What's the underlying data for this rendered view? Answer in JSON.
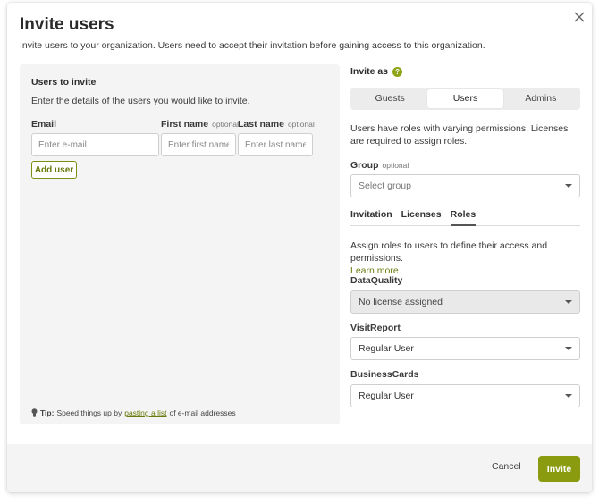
{
  "dialog": {
    "title": "Invite users",
    "subtitle": "Invite users to your organization. Users need to accept their invitation before gaining access to this organization.",
    "close_icon": "close-icon"
  },
  "users_panel": {
    "heading": "Users to invite",
    "description": "Enter the details of the users you would like to invite.",
    "email_label": "Email",
    "first_name_label": "First name",
    "last_name_label": "Last name",
    "optional": "optional",
    "email_placeholder": "Enter e-mail",
    "first_name_placeholder": "Enter first name",
    "last_name_placeholder": "Enter last name",
    "add_user_label": "Add user",
    "tip_label": "Tip:",
    "tip_before": "Speed things up by",
    "tip_link": "pasting a list",
    "tip_after": "of e-mail addresses"
  },
  "invite_as": {
    "label": "Invite as",
    "help_glyph": "?",
    "options": [
      "Guests",
      "Users",
      "Admins"
    ],
    "selected": "Users",
    "info": "Users have roles with varying permissions. Licenses are required to assign roles."
  },
  "group": {
    "label": "Group",
    "optional": "optional",
    "placeholder": "Select group"
  },
  "tabs": [
    "Invitation",
    "Licenses",
    "Roles"
  ],
  "active_tab": "Roles",
  "roles": {
    "description": "Assign roles to users to define their access and permissions.",
    "learn_more": "Learn more.",
    "items": [
      {
        "label": "DataQuality",
        "value": "No license assigned",
        "disabled": true
      },
      {
        "label": "VisitReport",
        "value": "Regular User",
        "disabled": false
      },
      {
        "label": "BusinessCards",
        "value": "Regular User",
        "disabled": false
      }
    ]
  },
  "footer": {
    "cancel_label": "Cancel",
    "invite_label": "Invite"
  },
  "colors": {
    "accent": "#8a9b0f",
    "link": "#6b7a0c"
  }
}
